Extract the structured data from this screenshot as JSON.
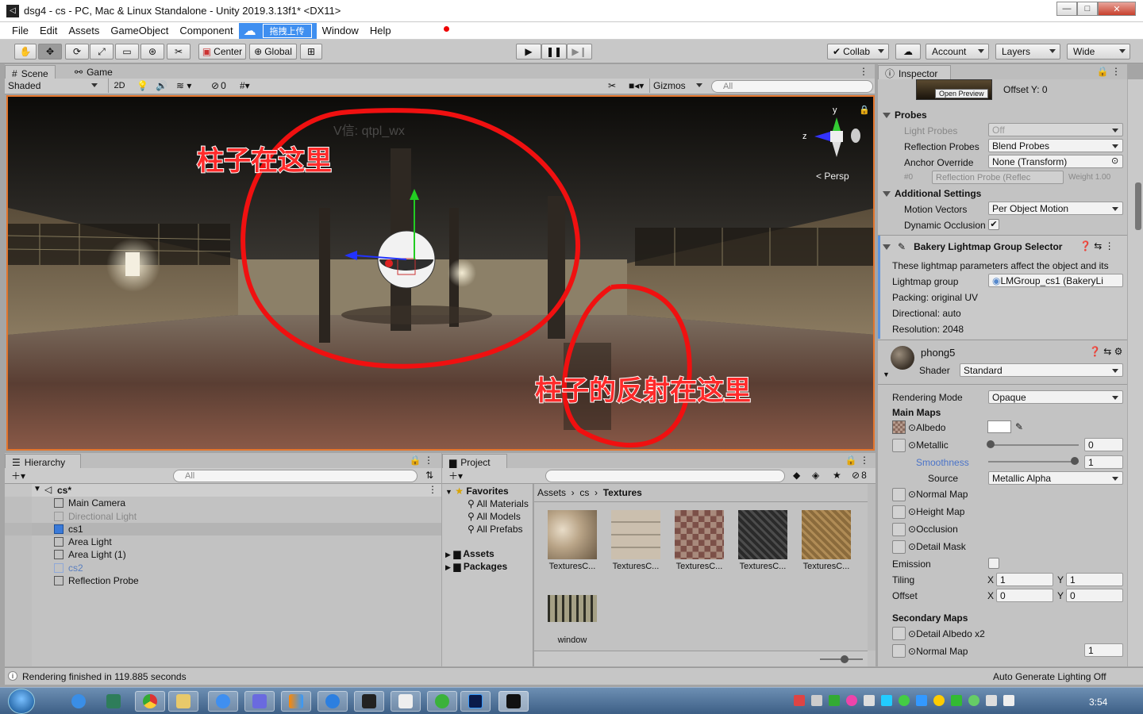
{
  "window": {
    "title": "dsg4 - cs - PC, Mac & Linux Standalone - Unity 2019.3.13f1* <DX11>",
    "min": "—",
    "max": "□",
    "close": "✕"
  },
  "menu": {
    "items": [
      "File",
      "Edit",
      "Assets",
      "GameObject",
      "Component"
    ],
    "upload": "拖拽上传",
    "items2": [
      "Window",
      "Help"
    ]
  },
  "toolbar": {
    "center": "Center",
    "global": "Global",
    "collab": "Collab",
    "account": "Account",
    "layers": "Layers",
    "layout": "Wide"
  },
  "scene": {
    "tabs": [
      "Scene",
      "Game"
    ],
    "shading": "Shaded",
    "mode2d": "2D",
    "hidden_count": "0",
    "gizmos": "Gizmos",
    "search": "All",
    "persp": "Persp",
    "axis_y": "y",
    "axis_z": "z",
    "annotation1": "柱子在这里",
    "annotation2": "柱子的反射在这里",
    "watermark": "V信: qtpl_wx"
  },
  "hierarchy": {
    "tab": "Hierarchy",
    "search": "All",
    "root": "cs*",
    "items": [
      "Main Camera",
      "Directional Light",
      "cs1",
      "Area Light",
      "Area Light (1)",
      "cs2",
      "Reflection Probe"
    ]
  },
  "project": {
    "tab": "Project",
    "hidden_count": "8",
    "favorites_label": "Favorites",
    "favorites": [
      "All Materials",
      "All Models",
      "All Prefabs"
    ],
    "roots": [
      "Assets",
      "Packages"
    ],
    "breadcrumb": [
      "Assets",
      "cs",
      "Textures"
    ],
    "assets": [
      "TexturesC...",
      "TexturesC...",
      "TexturesC...",
      "TexturesC...",
      "TexturesC...",
      "window"
    ]
  },
  "inspector": {
    "tab": "Inspector",
    "open_preview": "Open Preview",
    "offset_y": "Offset Y: 0",
    "probes": {
      "title": "Probes",
      "light_probes_label": "Light Probes",
      "light_probes": "Off",
      "reflection_label": "Reflection Probes",
      "reflection": "Blend Probes",
      "anchor_label": "Anchor Override",
      "anchor": "None (Transform)",
      "probe_idx": "#0",
      "probe_ref": "Reflection Probe (Reflec",
      "weight": "Weight 1.00"
    },
    "additional": {
      "title": "Additional Settings",
      "motion_label": "Motion Vectors",
      "motion": "Per Object Motion",
      "dynocc_label": "Dynamic Occlusion"
    },
    "bakery": {
      "title": "Bakery Lightmap Group Selector",
      "desc": "These lightmap parameters affect the object and its",
      "group_label": "Lightmap group",
      "group": "LMGroup_cs1 (BakeryLi",
      "packing": "Packing: original UV",
      "directional": "Directional: auto",
      "resolution": "Resolution: 2048"
    },
    "material": {
      "name": "phong5",
      "shader_label": "Shader",
      "shader": "Standard",
      "rendering_mode_label": "Rendering Mode",
      "rendering_mode": "Opaque",
      "main_maps": "Main Maps",
      "albedo": "Albedo",
      "metallic": "Metallic",
      "metallic_val": "0",
      "smoothness": "Smoothness",
      "smooth_val": "1",
      "source_label": "Source",
      "source": "Metallic Alpha",
      "normal": "Normal Map",
      "height": "Height Map",
      "occlusion": "Occlusion",
      "detail_mask": "Detail Mask",
      "emission": "Emission",
      "tiling": "Tiling",
      "offset": "Offset",
      "x": "X",
      "y": "Y",
      "tiling_x": "1",
      "tiling_y": "1",
      "offset_x": "0",
      "offset_y": "0",
      "secondary": "Secondary Maps",
      "detail_albedo": "Detail Albedo x2",
      "normal2": "Normal Map",
      "normal2_val": "1"
    }
  },
  "status": {
    "left": "Rendering finished in 119.885 seconds",
    "right": "Auto Generate Lighting Off"
  },
  "taskbar": {
    "clock": "3:54"
  }
}
